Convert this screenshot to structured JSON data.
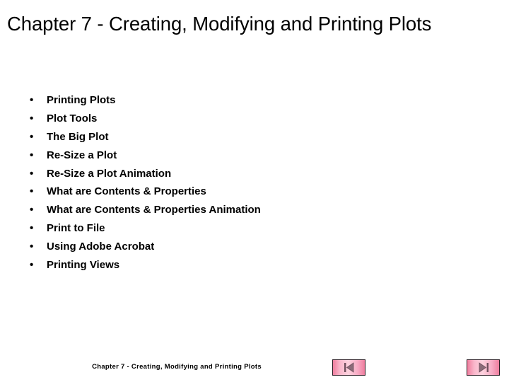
{
  "slide": {
    "title": "Chapter 7 - Creating, Modifying and Printing Plots",
    "background_color": "#ffffff",
    "text_color": "#000000",
    "bullet_marker": "•",
    "bullets": [
      {
        "label": "Printing Plots"
      },
      {
        "label": "Plot Tools"
      },
      {
        "label": "The Big Plot"
      },
      {
        "label": "Re-Size a Plot"
      },
      {
        "label": "Re-Size a Plot Animation"
      },
      {
        "label": "What are Contents & Properties"
      },
      {
        "label": "What are Contents & Properties Animation"
      },
      {
        "label": "Print to File"
      },
      {
        "label": "Using Adobe Acrobat"
      },
      {
        "label": "Printing Views"
      }
    ]
  },
  "footer": {
    "text": "Chapter 7 - Creating, Modifying and Printing Plots"
  },
  "navigation": {
    "previous": {
      "icon": "skip-to-first-icon",
      "accent_color": "#f2a0bb",
      "glyph_color": "#7a5a68",
      "border_color": "#2b1a22"
    },
    "next": {
      "icon": "skip-to-last-icon",
      "accent_color": "#f2a0bb",
      "glyph_color": "#7a5a68",
      "border_color": "#2b1a22"
    }
  }
}
